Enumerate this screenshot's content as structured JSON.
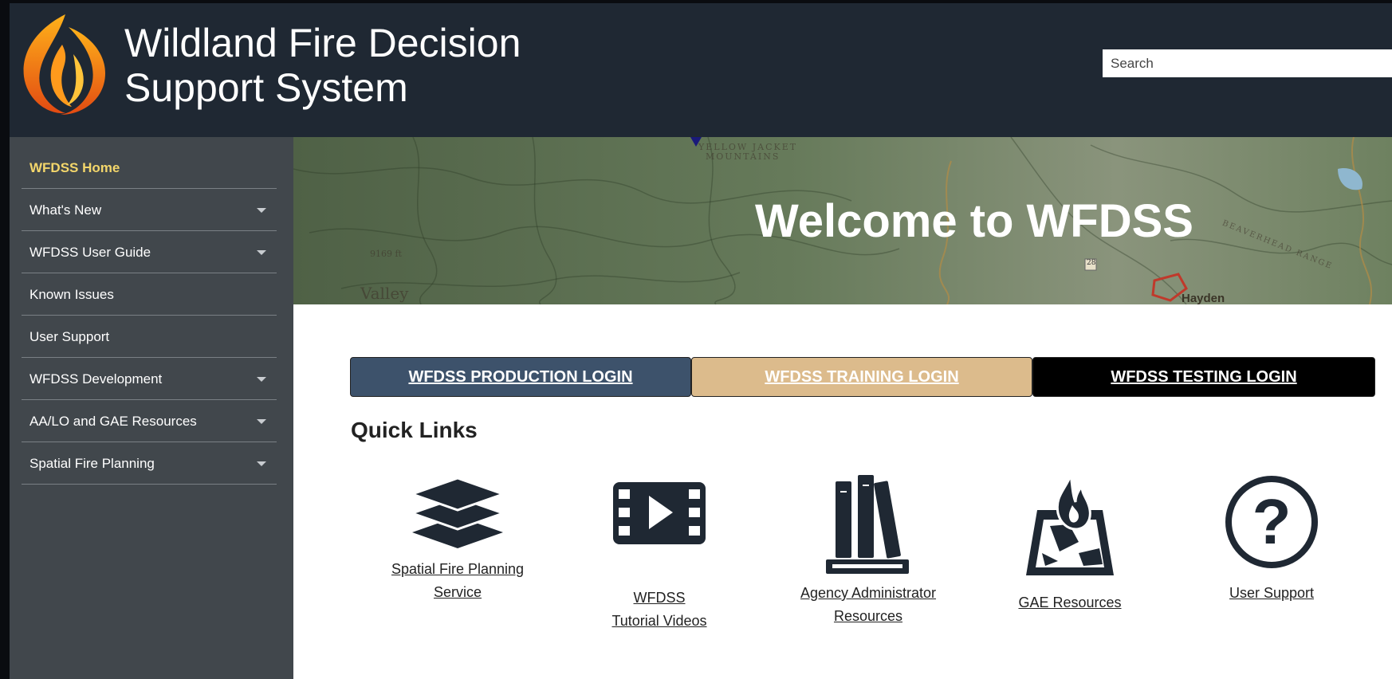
{
  "header": {
    "title_line1": "Wildland Fire Decision",
    "title_line2": "Support System",
    "logo_icon": "flame-logo-icon",
    "search_placeholder": "Search"
  },
  "sidebar": {
    "items": [
      {
        "label": "WFDSS Home",
        "active": true,
        "has_dropdown": false
      },
      {
        "label": "What's New",
        "has_dropdown": true
      },
      {
        "label": "WFDSS User Guide",
        "has_dropdown": true
      },
      {
        "label": "Known Issues",
        "has_dropdown": false
      },
      {
        "label": "User Support",
        "has_dropdown": false
      },
      {
        "label": "WFDSS Development",
        "has_dropdown": true
      },
      {
        "label": "AA/LO and GAE Resources",
        "has_dropdown": true
      },
      {
        "label": "Spatial Fire Planning",
        "has_dropdown": true
      }
    ]
  },
  "banner": {
    "title": "Welcome to WFDSS",
    "map_labels": [
      "Valley",
      "Hayden",
      "MOUNTAINS",
      "9169 ft",
      "28",
      "BEAVERHEAD RANGE",
      "YELLOW JACKET"
    ]
  },
  "logins": {
    "production": "WFDSS PRODUCTION LOGIN",
    "training": "WFDSS TRAINING LOGIN",
    "testing": "WFDSS TESTING LOGIN"
  },
  "quick_links": {
    "title": "Quick Links",
    "items": [
      {
        "line1": "Spatial Fire Planning",
        "line2": "Service",
        "icon": "layers-icon"
      },
      {
        "line1": "WFDSS",
        "line2": "Tutorial Videos",
        "icon": "video-icon"
      },
      {
        "line1": "Agency Administrator",
        "line2": "Resources",
        "icon": "books-icon"
      },
      {
        "line1": "GAE Resources",
        "line2": "",
        "icon": "fire-map-icon"
      },
      {
        "line1": "User Support",
        "line2": "",
        "icon": "help-icon"
      }
    ]
  },
  "colors": {
    "header_bg": "#1f2833",
    "sidebar_bg": "#41474c",
    "active_nav": "#f3d66b",
    "production_btn": "#3d526b",
    "training_btn": "#dcbb8c",
    "testing_btn": "#000000",
    "icon_color": "#1f2833"
  }
}
